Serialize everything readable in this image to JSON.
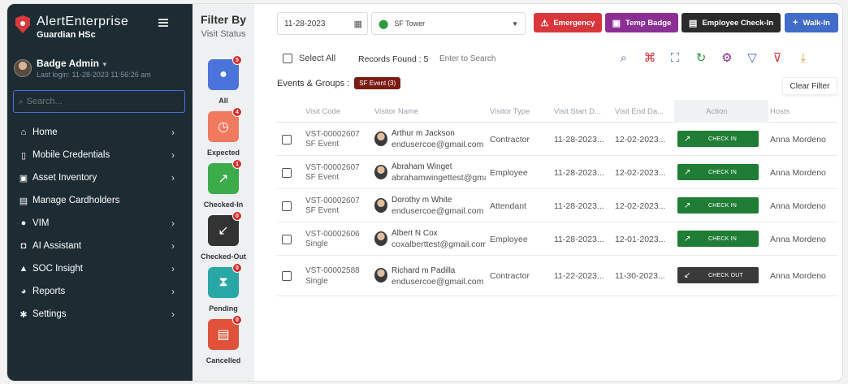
{
  "app": {
    "brand": "AlertEnterprise",
    "product": "Guardian HSc"
  },
  "user": {
    "name": "Badge Admin",
    "last_login": "Last login: 11-28-2023 11:56:26 am"
  },
  "sidebar": {
    "search_placeholder": "Search...",
    "items": [
      {
        "label": "Home",
        "icon": "home-icon",
        "has_chevron": true
      },
      {
        "label": "Mobile Credentials",
        "icon": "mobile-icon",
        "has_chevron": true
      },
      {
        "label": "Asset Inventory",
        "icon": "badge-icon",
        "has_chevron": true
      },
      {
        "label": "Manage Cardholders",
        "icon": "cardholders-icon",
        "has_chevron": false
      },
      {
        "label": "VIM",
        "icon": "person-icon",
        "has_chevron": true
      },
      {
        "label": "AI Assistant",
        "icon": "robot-icon",
        "has_chevron": true
      },
      {
        "label": "SOC Insight",
        "icon": "bell-icon",
        "has_chevron": true
      },
      {
        "label": "Reports",
        "icon": "pie-chart-icon",
        "has_chevron": true
      },
      {
        "label": "Settings",
        "icon": "gear-icon",
        "has_chevron": true
      }
    ]
  },
  "filter": {
    "title": "Filter By",
    "subtitle": "Visit Status",
    "statuses": [
      {
        "label": "All",
        "count": "5",
        "color": "#4a74d9",
        "icon": "person-icon"
      },
      {
        "label": "Expected",
        "count": "4",
        "color": "#f07a5e",
        "icon": "clock-icon"
      },
      {
        "label": "Checked-In",
        "count": "1",
        "color": "#3cab4a",
        "icon": "arrow-up-right-icon"
      },
      {
        "label": "Checked-Out",
        "count": "0",
        "color": "#333333",
        "icon": "arrow-down-left-icon"
      },
      {
        "label": "Pending",
        "count": "0",
        "color": "#29a7a7",
        "icon": "hourglass-icon"
      },
      {
        "label": "Cancelled",
        "count": "0",
        "color": "#e0533a",
        "icon": "cancel-doc-icon"
      }
    ]
  },
  "topbar": {
    "date": "11-28-2023",
    "location": "SF Tower",
    "buttons": [
      {
        "label": "Emergency",
        "color": "#d9363b",
        "icon": "warning-icon"
      },
      {
        "label": "Temp Badge",
        "color": "#8b2f95",
        "icon": "badge-icon"
      },
      {
        "label": "Employee Check-In",
        "color": "#2b2b2b",
        "icon": "checkin-doc-icon"
      },
      {
        "label": "Walk-In",
        "color": "#3f6cc9",
        "icon": "plus-icon"
      }
    ]
  },
  "toolbar": {
    "select_all": "Select All",
    "records_found": "Records Found : 5",
    "search_placeholder": "Enter to Search"
  },
  "events": {
    "label": "Events & Groups :",
    "chip": "SF Event (3)",
    "clear_filter": "Clear Filter"
  },
  "table": {
    "columns": [
      "Visit Code",
      "Visitor Name",
      "Visitor Type",
      "Visit Start D...",
      "Visit End Da...",
      "Action",
      "Hosts"
    ],
    "rows": [
      {
        "code": "VST-00002607",
        "group": "SF Event",
        "name": "Arthur m Jackson",
        "email": "endusercoe@gmail.com",
        "type": "Contractor",
        "start": "11-28-2023...",
        "end": "12-02-2023...",
        "action": "CHECK IN",
        "action_color": "#1f7d35",
        "host": "Anna Mordeno"
      },
      {
        "code": "VST-00002607",
        "group": "SF Event",
        "name": "Abraham Winget",
        "email": "abrahamwingettest@gmail.com",
        "type": "Employee",
        "start": "11-28-2023...",
        "end": "12-02-2023...",
        "action": "CHECK IN",
        "action_color": "#1f7d35",
        "host": "Anna Mordeno"
      },
      {
        "code": "VST-00002607",
        "group": "SF Event",
        "name": "Dorothy m White",
        "email": "endusercoe@gmail.com",
        "type": "Attendant",
        "start": "11-28-2023...",
        "end": "12-02-2023...",
        "action": "CHECK IN",
        "action_color": "#1f7d35",
        "host": "Anna Mordeno"
      },
      {
        "code": "VST-00002606",
        "group": "Single",
        "name": "Albert N Cox",
        "email": "coxalberttest@gmail.com",
        "type": "Employee",
        "start": "11-28-2023...",
        "end": "12-01-2023...",
        "action": "CHECK IN",
        "action_color": "#1f7d35",
        "host": "Anna Mordeno"
      },
      {
        "code": "VST-00002588",
        "group": "Single",
        "name": "Richard m Padilla",
        "email": "endusercoe@gmail.com",
        "type": "Contractor",
        "start": "11-22-2023...",
        "end": "11-30-2023...",
        "action": "CHECK OUT",
        "action_color": "#3a3a3a",
        "host": "Anna Mordeno"
      }
    ]
  }
}
